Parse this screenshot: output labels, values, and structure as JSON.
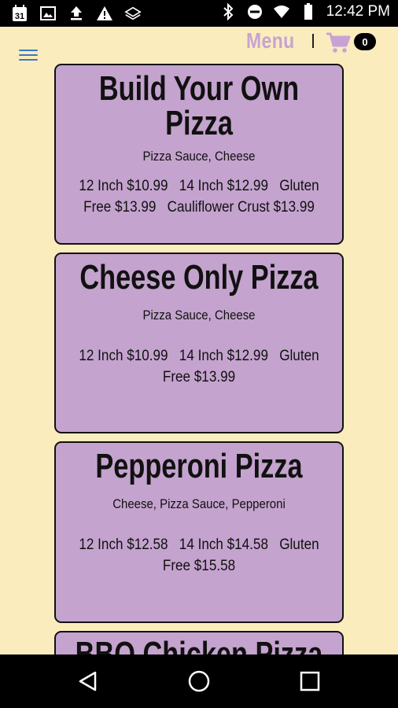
{
  "status_bar": {
    "time": "12:42 PM",
    "left_icons": [
      "calendar-icon",
      "image-icon",
      "upload-icon",
      "warning-icon",
      "layers-icon"
    ],
    "right_icons": [
      "bluetooth-icon",
      "do-not-disturb-icon",
      "wifi-icon",
      "battery-icon"
    ],
    "calendar_day": "31"
  },
  "header": {
    "menu_label": "Menu",
    "cart_count": "0"
  },
  "menu_items": [
    {
      "title": "Build Your Own Pizza",
      "description": "Pizza Sauce, Cheese",
      "prices_line1": "12 Inch $10.99   14 Inch $12.99   Gluten",
      "prices_line2": "Free $13.99   Cauliflower Crust $13.99"
    },
    {
      "title": "Cheese Only Pizza",
      "description": "Pizza Sauce, Cheese",
      "prices_line1": "12 Inch $10.99   14 Inch $12.99   Gluten",
      "prices_line2": "Free $13.99"
    },
    {
      "title": "Pepperoni Pizza",
      "description": "Cheese, Pizza Sauce, Pepperoni",
      "prices_line1": "12 Inch $12.58   14 Inch $14.58   Gluten",
      "prices_line2": "Free $15.58"
    },
    {
      "title": "BBQ Chicken Pizza"
    }
  ],
  "nav_bar": {
    "buttons": [
      "back-icon",
      "home-icon",
      "recents-icon"
    ]
  },
  "colors": {
    "background": "#fbecbd",
    "card": "#c4a3ce",
    "accent": "#c7a3d3",
    "hamburger": "#3b78c0"
  }
}
